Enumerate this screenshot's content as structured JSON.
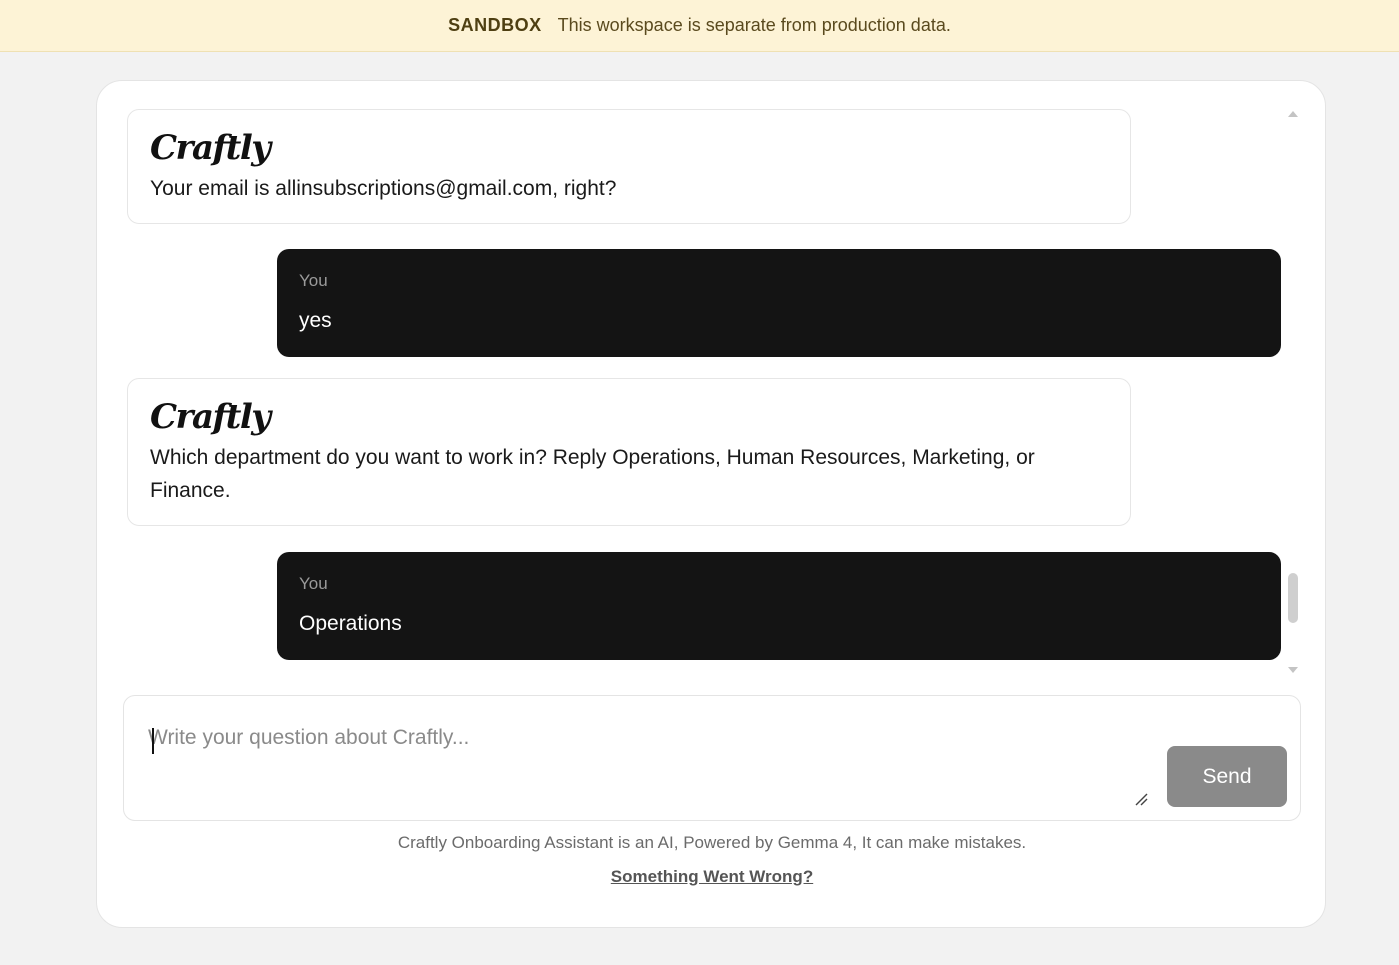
{
  "banner": {
    "tag": "SANDBOX",
    "message": "This workspace is separate from production data."
  },
  "messages": [
    {
      "role": "assistant",
      "logo": "Craftly",
      "text": "Your email is allinsubscriptions@gmail.com, right?"
    },
    {
      "role": "user",
      "label": "You",
      "text": "yes"
    },
    {
      "role": "assistant",
      "logo": "Craftly",
      "text": "Which department do you want to work in? Reply Operations, Human Resources, Marketing, or Finance."
    },
    {
      "role": "user",
      "label": "You",
      "text": "Operations"
    }
  ],
  "composer": {
    "placeholder": "Write your question about Craftly...",
    "value": "",
    "send_label": "Send"
  },
  "footer": {
    "disclaimer": "Craftly Onboarding Assistant is an AI, Powered by Gemma 4, It can make mistakes.",
    "report_link": "Something Went Wrong?"
  },
  "colors": {
    "banner_bg": "#fdf3d6",
    "user_bubble": "#141414",
    "send_button": "#8a8a8a"
  }
}
